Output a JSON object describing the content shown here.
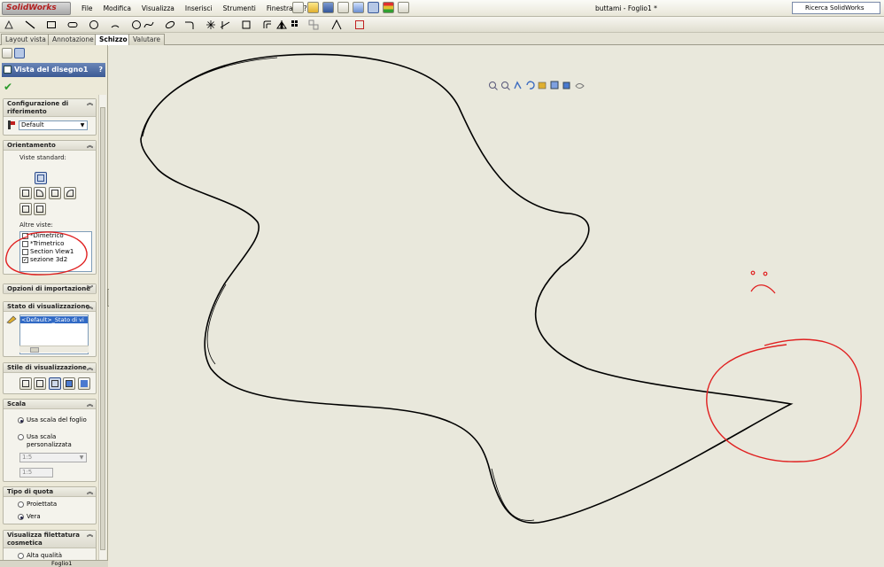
{
  "app": {
    "logo": "SolidWorks",
    "document_title": "buttami - Foglio1 *",
    "search_placeholder": "Ricerca SolidWorks"
  },
  "menu": [
    "File",
    "Modifica",
    "Visualizza",
    "Inserisci",
    "Strumenti",
    "Finestra",
    "?"
  ],
  "tabs": [
    {
      "label": "Layout vista",
      "active": false
    },
    {
      "label": "Annotazione",
      "active": false
    },
    {
      "label": "Schizzo",
      "active": true
    },
    {
      "label": "Valutare",
      "active": false
    }
  ],
  "property_manager": {
    "title": "Vista del disegno1",
    "help": "?",
    "groups": {
      "reference_config": {
        "title": "Configurazione di riferimento",
        "value": "Default"
      },
      "orientation": {
        "title": "Orientamento",
        "standard_views_label": "Viste standard:",
        "other_views_label": "Altre viste:",
        "other_views": [
          {
            "label": "*Dimetrico",
            "checked": false
          },
          {
            "label": "*Trimetrico",
            "checked": false
          },
          {
            "label": "Section View1",
            "checked": false
          },
          {
            "label": "sezione 3d2",
            "checked": true
          }
        ]
      },
      "import_options": {
        "title": "Opzioni di importazione"
      },
      "display_state": {
        "title": "Stato di visualizzazione",
        "selected": "<Default>_Stato di vi"
      },
      "display_style": {
        "title": "Stile di visualizzazione"
      },
      "scale": {
        "title": "Scala",
        "option_sheet": "Usa scala del foglio",
        "option_custom": "Usa scala personalizzata",
        "combo_value": "1:5",
        "field_value": "1:5"
      },
      "dimension_type": {
        "title": "Tipo di quota",
        "option_projected": "Proiettata",
        "option_true": "Vera"
      },
      "cosmetic_thread": {
        "title": "Visualizza filettatura cosmetica",
        "option_high": "Alta qualità"
      }
    }
  },
  "status": {
    "sheet_tab": "Foglio1"
  },
  "colors": {
    "annotation": "#e02020",
    "selection": "#316ac5",
    "header": "#3c5a94"
  }
}
